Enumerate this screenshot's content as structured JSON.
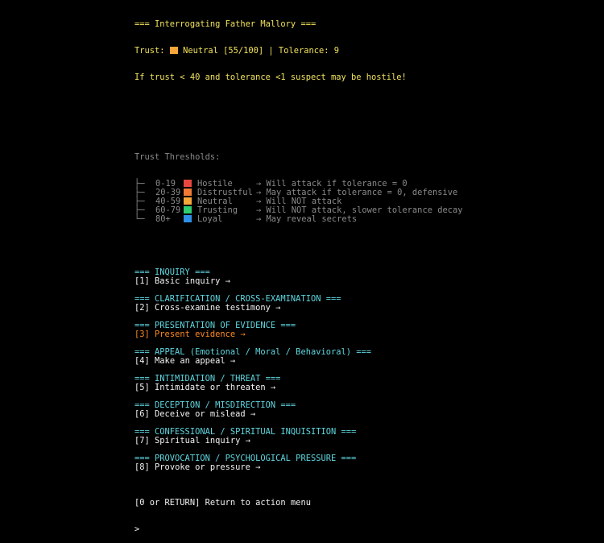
{
  "header": {
    "title": "=== Interrogating Father Mallory ===",
    "trust_prefix": "Trust:",
    "trust_status": "Neutral [55/100] | Tolerance: 9",
    "trust_color": "#f7a63a",
    "warning": "If trust < 40 and tolerance <1 suspect may be hostile!"
  },
  "thresholds": {
    "title": "Trust Thresholds:",
    "rows": [
      {
        "tree": "├─",
        "range": "0-19",
        "color": "#e8473f",
        "label": "Hostile",
        "desc": "→ Will attack if tolerance = 0"
      },
      {
        "tree": "├─",
        "range": "20-39",
        "color": "#f07a35",
        "label": "Distrustful",
        "desc": "→ May attack if tolerance = 0, defensive"
      },
      {
        "tree": "├─",
        "range": "40-59",
        "color": "#f7a63a",
        "label": "Neutral",
        "desc": "→ Will NOT attack"
      },
      {
        "tree": "├─",
        "range": "60-79",
        "color": "#2ecc71",
        "label": "Trusting",
        "desc": "→ Will NOT attack, slower tolerance decay"
      },
      {
        "tree": "└─",
        "range": "80+",
        "color": "#2e8fe6",
        "label": "Loyal",
        "desc": "→ May reveal secrets"
      }
    ]
  },
  "sections": [
    {
      "heading": "=== INQUIRY ===",
      "key": "[1]",
      "option": "Basic inquiry →",
      "highlighted": false
    },
    {
      "heading": "=== CLARIFICATION / CROSS-EXAMINATION ===",
      "key": "[2]",
      "option": "Cross-examine testimony →",
      "highlighted": false
    },
    {
      "heading": "=== PRESENTATION OF EVIDENCE ===",
      "key": "[3]",
      "option": "Present evidence →",
      "highlighted": true
    },
    {
      "heading": "=== APPEAL (Emotional / Moral / Behavioral) ===",
      "key": "[4]",
      "option": "Make an appeal →",
      "highlighted": false
    },
    {
      "heading": "=== INTIMIDATION / THREAT ===",
      "key": "[5]",
      "option": "Intimidate or threaten →",
      "highlighted": false
    },
    {
      "heading": "=== DECEPTION / MISDIRECTION ===",
      "key": "[6]",
      "option": "Deceive or mislead →",
      "highlighted": false
    },
    {
      "heading": "=== CONFESSIONAL / SPIRITUAL INQUISITION ===",
      "key": "[7]",
      "option": "Spiritual inquiry →",
      "highlighted": false
    },
    {
      "heading": "=== PROVOCATION / PSYCHOLOGICAL PRESSURE ===",
      "key": "[8]",
      "option": "Provoke or pressure →",
      "highlighted": false
    }
  ],
  "footer": {
    "return_label": "[0 or RETURN] Return to action menu",
    "prompt": ">"
  }
}
